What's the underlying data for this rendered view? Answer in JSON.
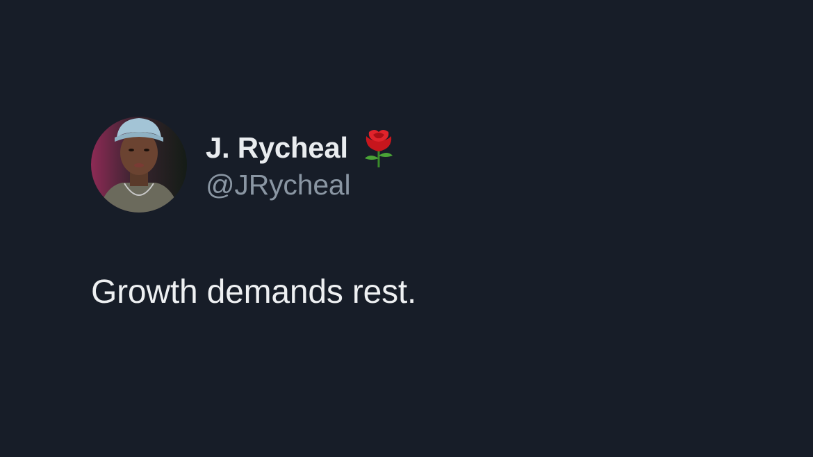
{
  "tweet": {
    "author": {
      "display_name": "J. Rycheal",
      "handle": "@JRycheal",
      "name_emoji_icon": "rose-icon",
      "avatar_icon": "profile-photo"
    },
    "text": "Growth demands rest."
  },
  "colors": {
    "background": "#171d28",
    "display_name": "#e9ecef",
    "handle": "#8a96a3",
    "tweet_text": "#eef0f2"
  }
}
